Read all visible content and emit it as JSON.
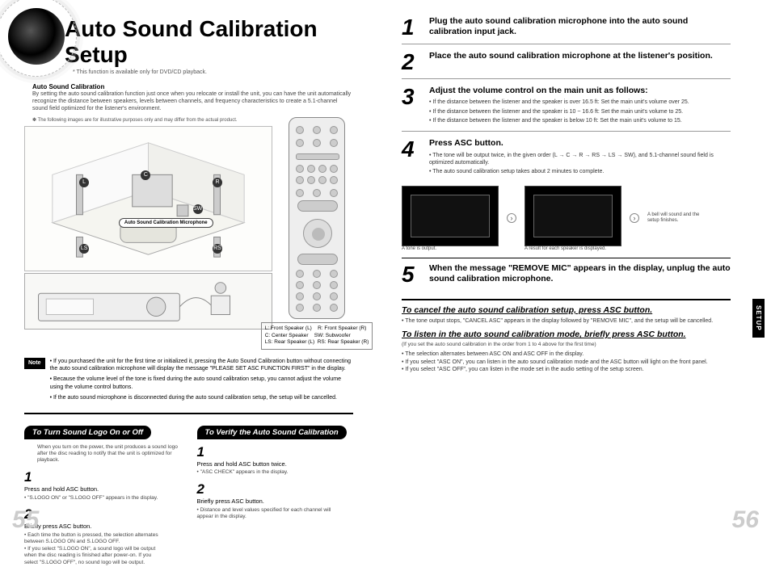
{
  "title": "Auto Sound Calibration Setup",
  "subtitle": "* This function is available only for DVD/CD playback.",
  "asc": {
    "heading": "Auto Sound Calibration",
    "body": "By setting the auto sound calibration function just once when you relocate or install the unit, you can have the unit automatically recognize the distance between speakers, levels between channels, and frequency characteristics to create a 5.1-channel sound field optimized for the listener's environment."
  },
  "img_note": "✽ The following images are for illustrative purposes only and may differ from the actual product.",
  "mic_label": "Auto Sound Calibration Microphone",
  "speaker_key": {
    "l": "L: Front Speaker (L)",
    "r": "R: Front Speaker (R)",
    "c": "C: Center Speaker",
    "sw": "SW: Subwoofer",
    "ls": "LS: Rear Speaker (L)",
    "rs": "RS: Rear Speaker (R)"
  },
  "note_label": "Note",
  "notes": {
    "n1": "• If you purchased the unit for the first time or initialized it, pressing the Auto Sound Calibration button without connecting the auto sound calibration microphone will display the message \"PLEASE SET ASC FUNCTION FIRST\" in the display.",
    "n2": "• Because the volume level of the tone is fixed during the auto sound calibration setup, you cannot adjust the volume using the volume control buttons.",
    "n3": "• If the auto sound microphone is disconnected during the auto sound calibration setup, the setup will be cancelled."
  },
  "left_lower": {
    "col1": {
      "title": "To Turn Sound Logo On or Off",
      "intro": "When you turn on the power, the unit produces a sound logo after the disc reading to notify that the unit is optimized for playback.",
      "s1_main": "Press and hold ASC button.",
      "s1_sub": "• \"S.LOGO ON\" or \"S.LOGO OFF\" appears in the display.",
      "s2_main": "Briefly press ASC button.",
      "s2_sub1": "• Each time the button is pressed, the selection alternates between S.LOGO ON and S.LOGO OFF.",
      "s2_sub2": "• If you select \"S.LOGO ON\", a sound logo will be output when the disc reading is finished after power-on. If you select \"S.LOGO OFF\", no sound logo will be output."
    },
    "col2": {
      "title": "To Verify the Auto Sound Calibration",
      "s1_main": "Press and hold ASC button twice.",
      "s1_sub": "• \"ASC CHECK\" appears in the display.",
      "s2_main": "Briefly press ASC button.",
      "s2_sub": "• Distance and level values specified for each channel will appear in the display."
    }
  },
  "right": {
    "s1": "Plug the auto sound calibration microphone into the auto sound calibration input jack.",
    "s2": "Place the auto sound calibration microphone at the listener's position.",
    "s3_title": "Adjust the volume control on the main unit as follows:",
    "s3_b1": "• If the distance between the listener and the speaker is over 16.5 ft: Set the main unit's volume over 25.",
    "s3_b2": "• If the distance between the listener and the speaker is 10 ~ 16.6 ft: Set the main unit's volume to 25.",
    "s3_b3": "• If the distance between the listener and the speaker is below 10 ft: Set the main unit's volume to 15.",
    "s4_title": "Press ASC button.",
    "s4_b1": "• The tone will be output twice, in the given order (L → C → R → RS → LS → SW), and 5.1-channel sound field is optimized automatically.",
    "s4_b2": "• The auto sound calibration setup takes about 2 minutes to complete.",
    "screen1_cap": "A tone is output.",
    "screen2_cap": "A result for each speaker is displayed.",
    "bell_note": "A bell will sound and the setup finishes.",
    "s5": "When the message \"REMOVE MIC\" appears in the display, unplug the auto sound calibration microphone.",
    "cancel_h": "To cancel the auto sound calibration setup, press ASC button.",
    "cancel_b": "• The tone output stops, \"CANCEL ASC\" appears in the display followed by \"REMOVE MIC\", and the setup will be cancelled.",
    "listen_h": "To listen in the auto sound calibration mode, briefly press ASC button.",
    "listen_note": "(If you set the auto sound calibration in the order from 1 to 4 above for the first time)",
    "listen_b1": "• The selection alternates between ASC ON and ASC OFF in the display.",
    "listen_b2": "• If you select \"ASC ON\", you can listen in the auto sound calibration mode and the ASC button will light on the front panel.",
    "listen_b3": "• If you select \"ASC OFF\", you can listen in the mode set in the audio setting of the setup screen."
  },
  "tab": "SETUP",
  "page_left": "55",
  "page_right": "56"
}
